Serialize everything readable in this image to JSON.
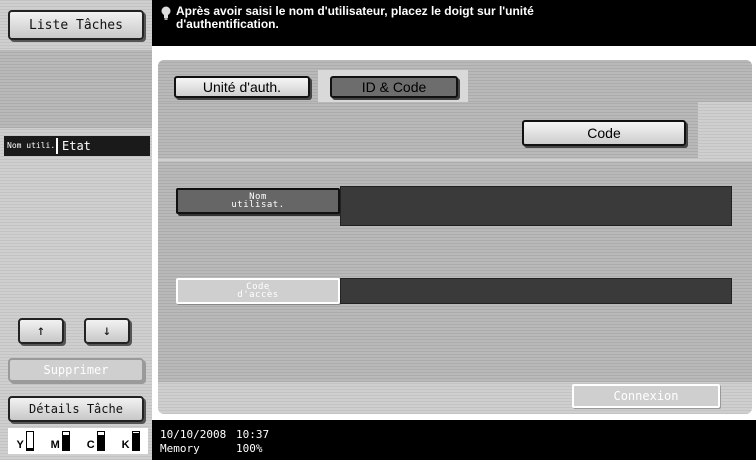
{
  "sidebar": {
    "task_list_button": "Liste Tâches",
    "list_header": {
      "user_col": "Nom utili.",
      "state_col": "Etat"
    },
    "up_arrow": "↑",
    "down_arrow": "↓",
    "delete_button": "Supprimer",
    "details_button": "Détails Tâche",
    "toner": [
      {
        "label": "Y",
        "level": 0.1
      },
      {
        "label": "M",
        "level": 0.85
      },
      {
        "label": "C",
        "level": 0.85
      },
      {
        "label": "K",
        "level": 0.95
      }
    ]
  },
  "message": {
    "icon": "lightbulb-icon",
    "text": "Après avoir saisi le nom d'utilisateur, placez le doigt sur l'unité d'authentification."
  },
  "tabs": {
    "auth_unit": "Unité d'auth.",
    "id_code": "ID & Code"
  },
  "code_button": "Code",
  "fields": {
    "user_label": [
      "Nom",
      "utilisat."
    ],
    "code_label": [
      "Code",
      "d'accès"
    ],
    "user_value": "",
    "code_value": ""
  },
  "login_button": "Connexion",
  "status": {
    "date": "10/10/2008",
    "time": "10:37",
    "memory_label": "Memory",
    "memory_value": "100%"
  }
}
